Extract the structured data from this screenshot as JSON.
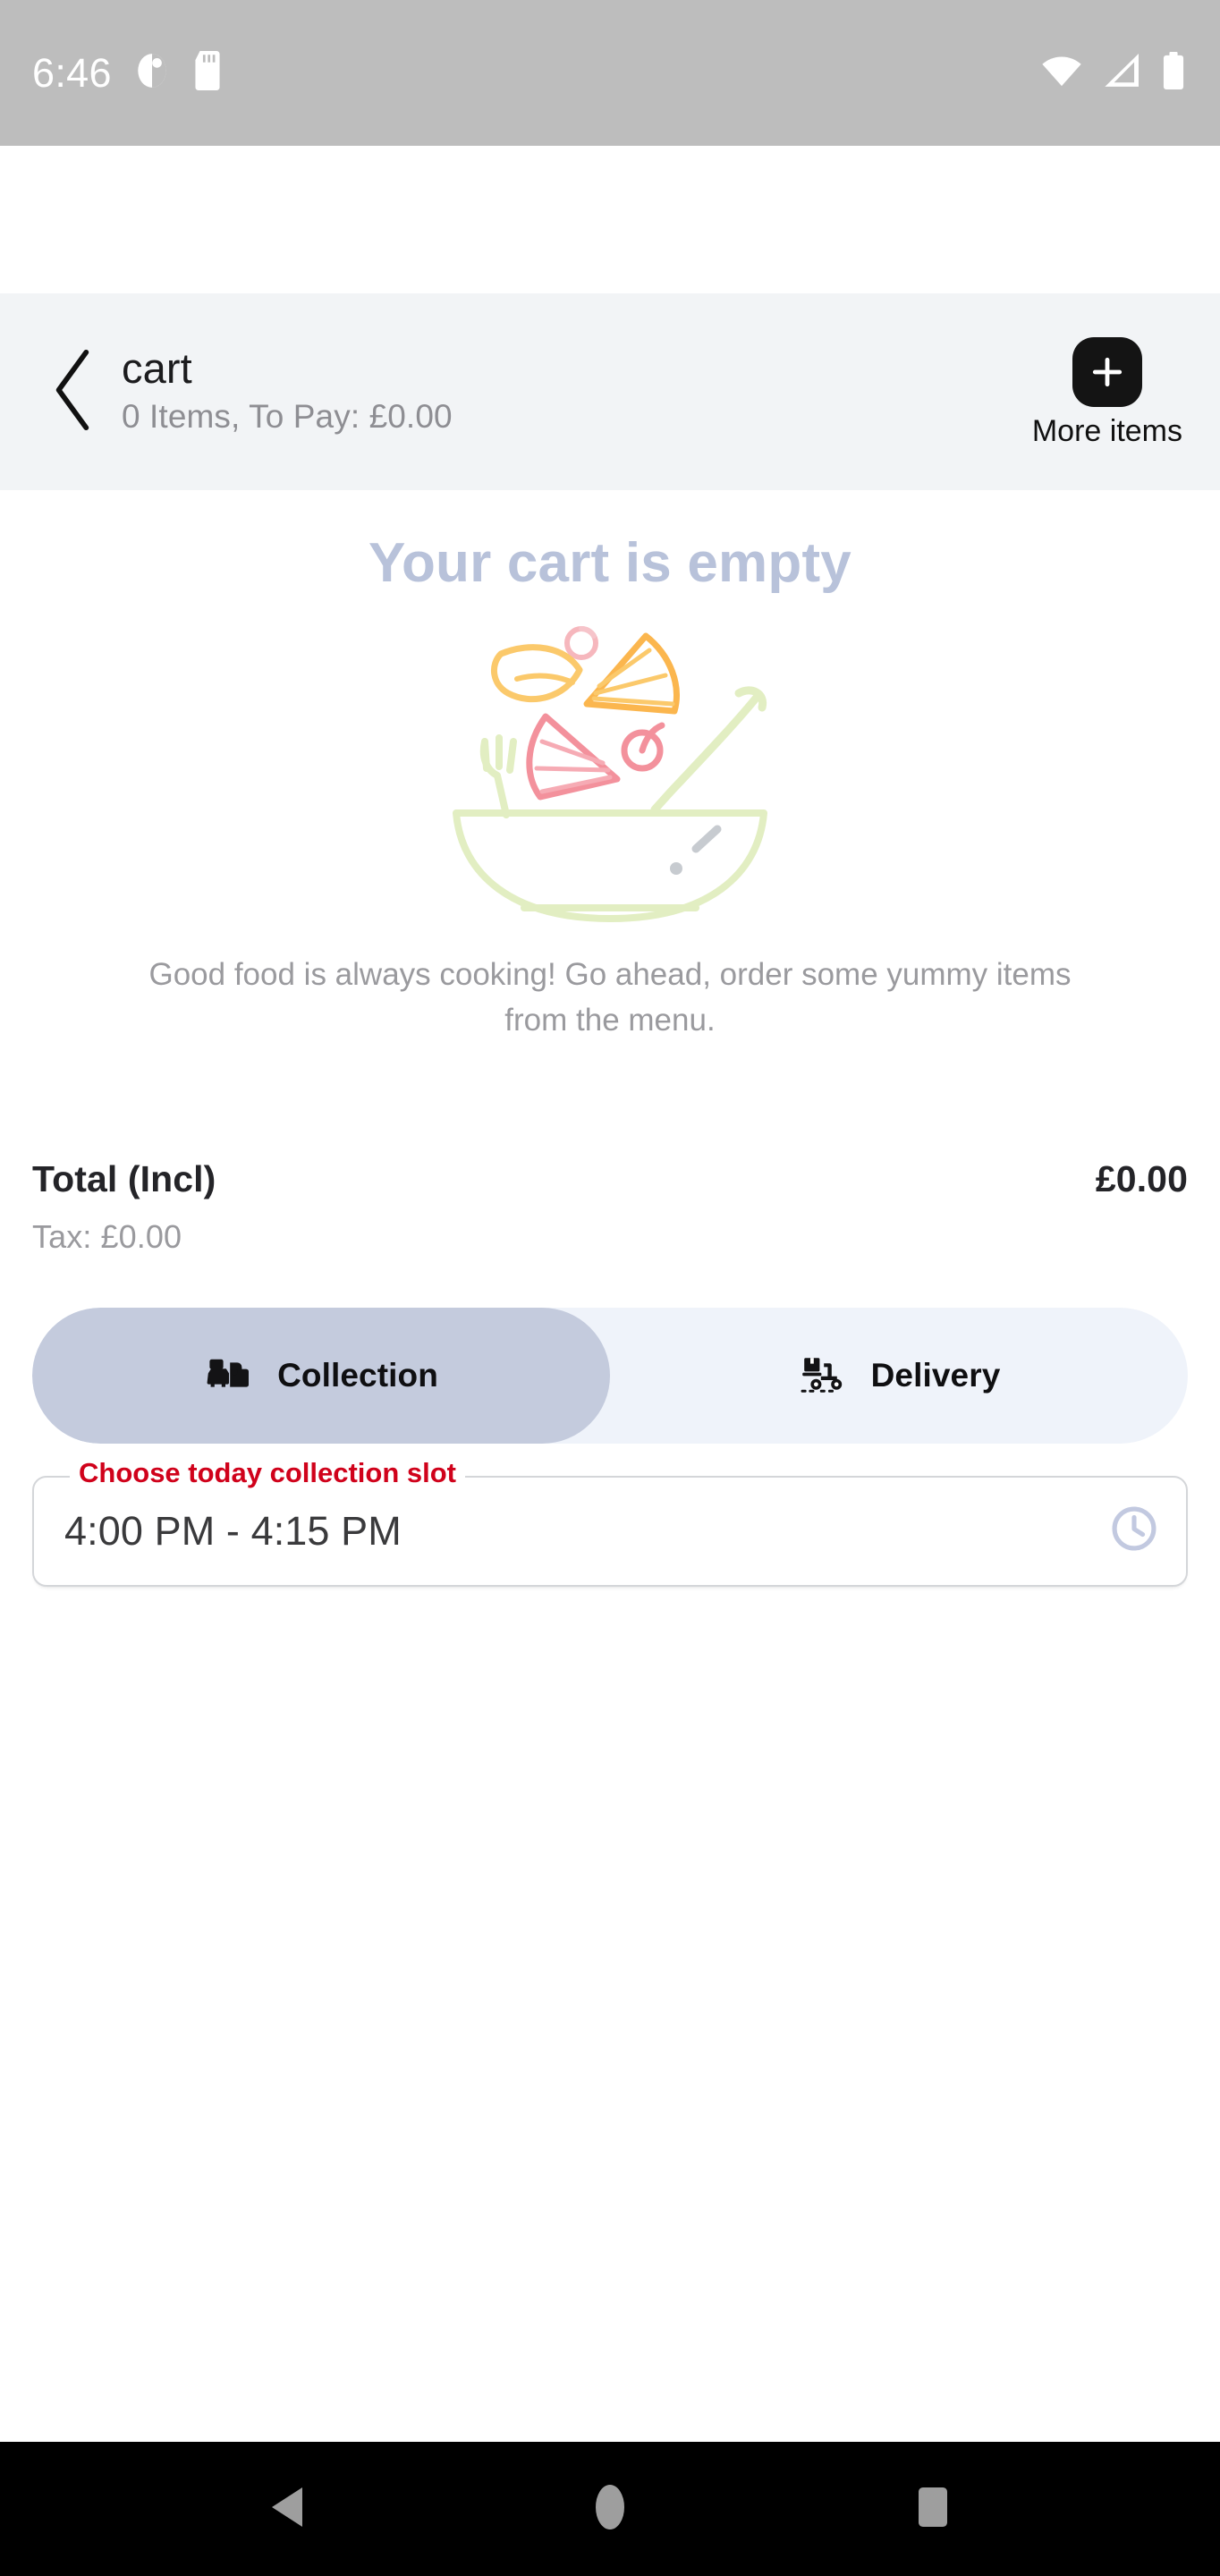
{
  "status_bar": {
    "time": "6:46",
    "icons_left": [
      "do-not-disturb-icon",
      "sd-card-icon"
    ],
    "icons_right": [
      "wifi-icon",
      "cellular-signal-icon",
      "battery-icon"
    ],
    "background": "#bdbdbd"
  },
  "app_bar": {
    "back_icon": "chevron-left-icon",
    "title": "cart",
    "subtitle": "0 Items, To Pay: £0.00",
    "action": {
      "icon": "plus-icon",
      "label": "More items"
    },
    "background": "#f2f4f6"
  },
  "empty_state": {
    "title": "Your cart is empty",
    "title_color": "#b8c2da",
    "illustration": "salad-bowl-icon",
    "description": "Good food is always cooking! Go ahead, order some yummy items from the menu.",
    "description_color": "#9a9a9e"
  },
  "totals": {
    "total_label": "Total (Incl)",
    "total_value": "£0.00",
    "tax_label": "Tax: £0.00"
  },
  "fulfilment": {
    "options": [
      {
        "label": "Collection",
        "icon": "car-collection-icon",
        "selected": true
      },
      {
        "label": "Delivery",
        "icon": "scooter-delivery-icon",
        "selected": false
      }
    ],
    "selected_color": "#c4cbdd",
    "track_color": "#eff3fa"
  },
  "slot_field": {
    "label": "Choose today collection slot",
    "label_color": "#d0021b",
    "value": "4:00 PM - 4:15 PM",
    "trailing_icon": "clock-icon",
    "trailing_icon_color": "#c2c9e0"
  },
  "nav_bar": {
    "buttons": [
      "back-triangle-icon",
      "home-circle-icon",
      "recents-square-icon"
    ],
    "background": "#000000",
    "icon_color": "#9e9e9e"
  }
}
